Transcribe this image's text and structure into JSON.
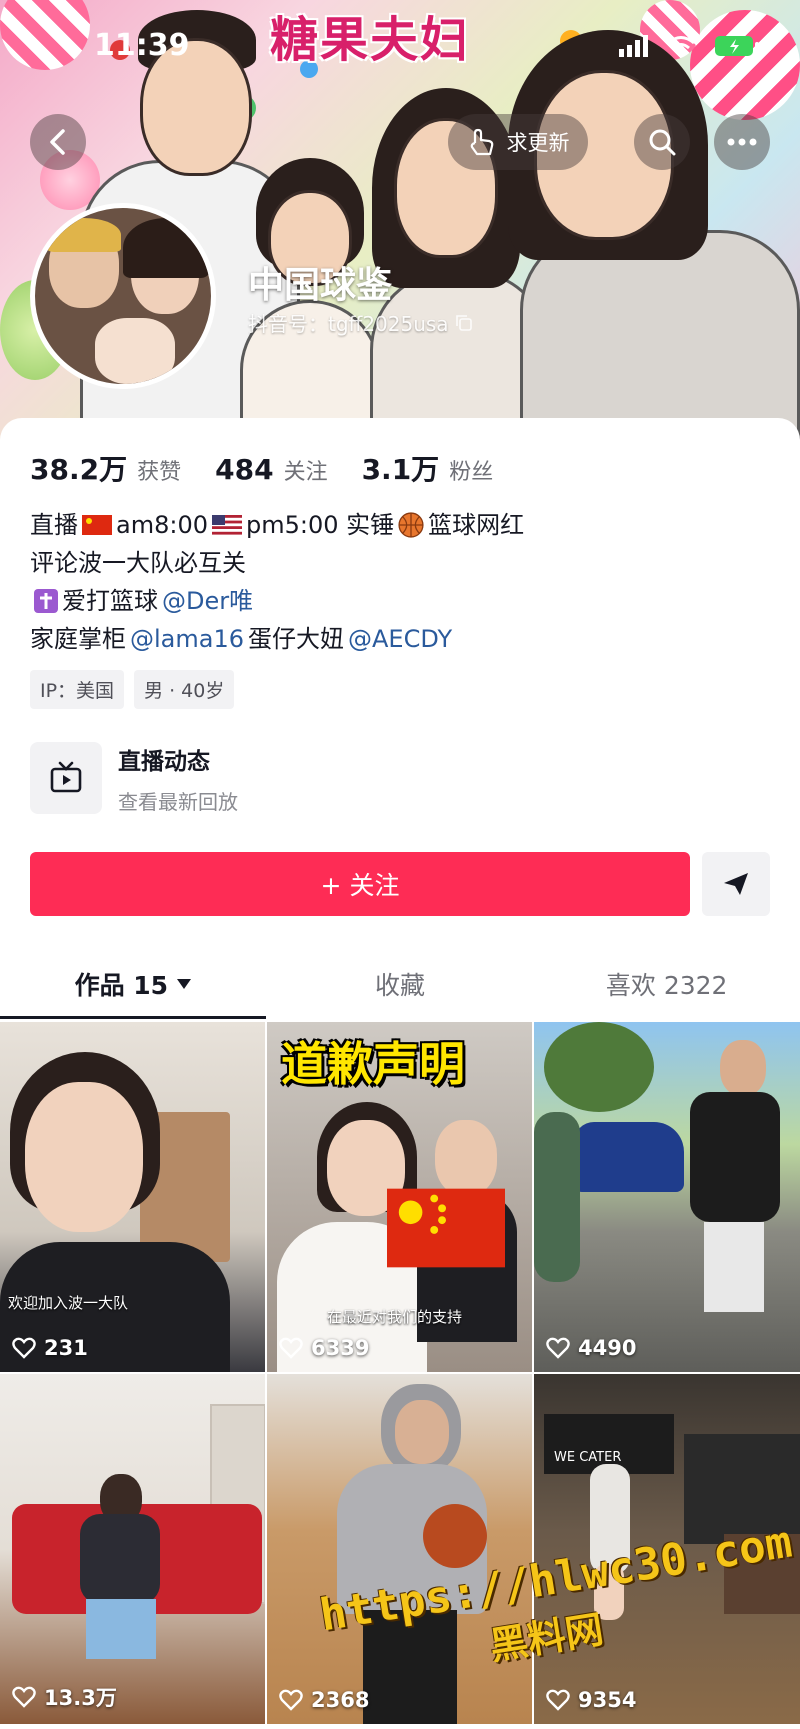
{
  "status_bar": {
    "time": "11:39"
  },
  "header": {
    "banner_title": "糖果夫妇",
    "request_update_label": "求更新",
    "nickname": "中国球鉴",
    "douyin_id": "抖音号：tgff2025usa"
  },
  "stats": {
    "likes_value": "38.2万",
    "likes_label": "获赞",
    "following_value": "484",
    "following_label": "关注",
    "followers_value": "3.1万",
    "followers_label": "粉丝"
  },
  "bio": {
    "line1_a": "直播",
    "line1_b": "am8:00",
    "line1_c": "pm5:00 实锤",
    "line1_d": "篮球网红",
    "line2": "评论波一大队必互关",
    "line3_a": "爱打篮球",
    "line3_mention": "@Der唯",
    "line4_a": "家庭掌柜",
    "line4_mention1": "@lama16",
    "line4_b": "蛋仔大妞",
    "line4_mention2": "@AECDY"
  },
  "tags": {
    "ip": "IP：美国",
    "gender_age": "男 · 40岁"
  },
  "live": {
    "title": "直播动态",
    "subtitle": "查看最新回放"
  },
  "actions": {
    "follow_label": "+ 关注"
  },
  "tabs": {
    "works": "作品 15",
    "favorites": "收藏",
    "likes": "喜欢 2322"
  },
  "videos": [
    {
      "likes": "231",
      "caption": "欢迎加入波一大队"
    },
    {
      "likes": "6339",
      "title": "道歉声明",
      "caption": "在最近对我们的支持"
    },
    {
      "likes": "4490"
    },
    {
      "likes": "13.3万"
    },
    {
      "likes": "2368"
    },
    {
      "likes": "9354",
      "sign": "WE CATER"
    }
  ],
  "watermark": {
    "url": "https://hlwc30.com",
    "name": "黑料网"
  },
  "colors": {
    "accent": "#fe2c55",
    "mention": "#2a5a9c",
    "text": "#161823"
  }
}
